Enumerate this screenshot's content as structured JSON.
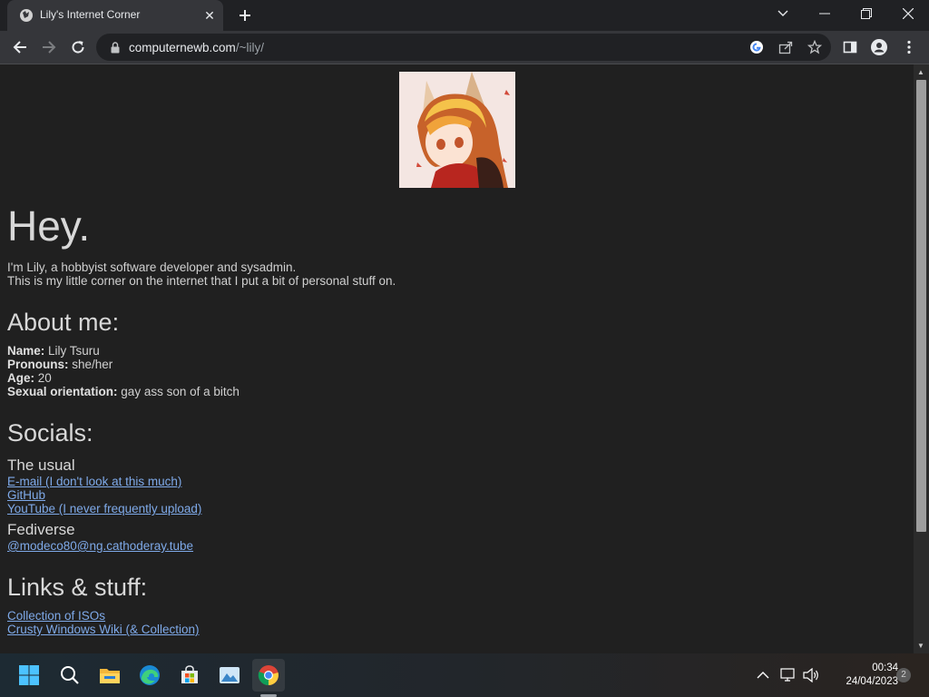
{
  "browser": {
    "tab_title": "Lily's Internet Corner",
    "url_host": "computernewb.com",
    "url_path": "/~lily/"
  },
  "page": {
    "heading": "Hey.",
    "intro": [
      "I'm Lily, a hobbyist software developer and sysadmin.",
      "This is my little corner on the internet that I put a bit of personal stuff on."
    ],
    "about": {
      "title": "About me:",
      "fields": [
        {
          "label": "Name:",
          "value": "Lily Tsuru"
        },
        {
          "label": "Pronouns:",
          "value": "she/her"
        },
        {
          "label": "Age:",
          "value": "20"
        },
        {
          "label": "Sexual orientation:",
          "value": "gay ass son of a bitch"
        }
      ]
    },
    "socials": {
      "title": "Socials:",
      "usual_title": "The usual",
      "usual_links": [
        "E-mail (I don't look at this much)",
        "GitHub",
        "YouTube (I never frequently upload)"
      ],
      "fediverse_title": "Fediverse",
      "fediverse_links": [
        "@modeco80@ng.cathoderay.tube"
      ]
    },
    "links": {
      "title": "Links & stuff:",
      "items": [
        "Collection of ISOs",
        "Crusty Windows Wiki (& Collection)"
      ]
    }
  },
  "taskbar": {
    "time": "00:34",
    "date": "24/04/2023",
    "notification_count": "2",
    "apps": [
      "start-icon",
      "search-icon",
      "file-explorer-icon",
      "edge-icon",
      "store-icon",
      "photos-icon",
      "chrome-icon"
    ]
  },
  "colors": {
    "page_bg": "#202020",
    "link": "#7ea9e8",
    "chrome_frame": "#202124",
    "chrome_toolbar": "#35363a"
  }
}
